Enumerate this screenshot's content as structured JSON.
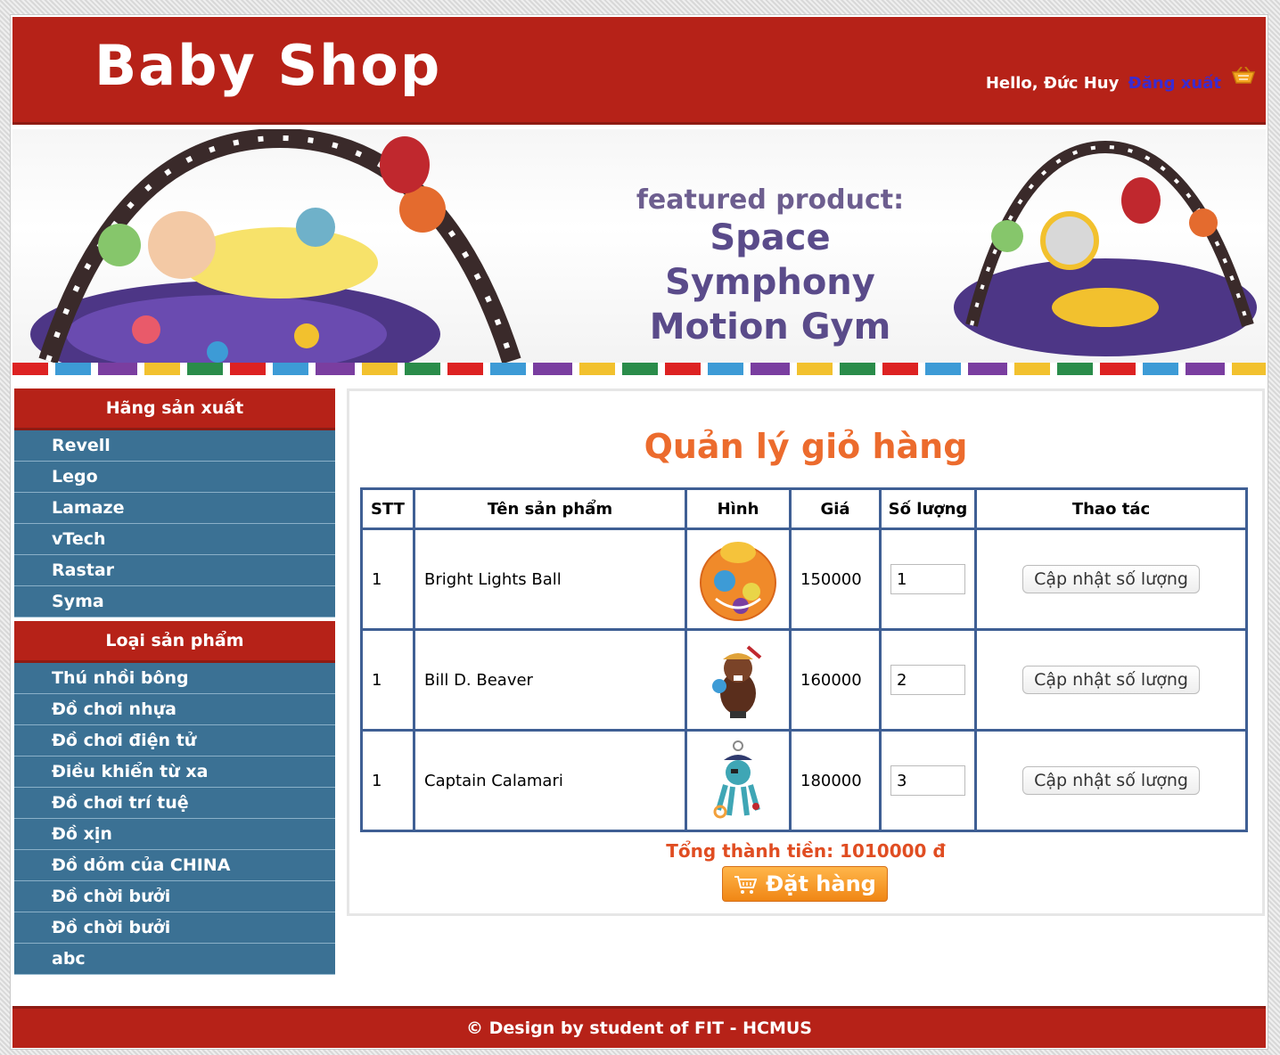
{
  "header": {
    "logo": "Baby Shop",
    "greeting": "Hello, Đức Huy",
    "logout": "Đăng xuất",
    "cart_icon": "basket-icon"
  },
  "banner": {
    "line1": "featured product:",
    "line2": "Space Symphony",
    "line3": "Motion Gym"
  },
  "sidebar": {
    "manufacturers_title": "Hãng sản xuất",
    "manufacturers": [
      "Revell",
      "Lego",
      "Lamaze",
      "vTech",
      "Rastar",
      "Syma"
    ],
    "categories_title": "Loại sản phẩm",
    "categories": [
      "Thú nhồi bông",
      "Đồ chơi nhựa",
      "Đồ chơi điện tử",
      "Điều khiển từ xa",
      "Đồ chơi trí tuệ",
      "Đồ xịn",
      "Đồ dỏm của CHINA",
      "Đồ chời bưởi",
      "Đồ chời bưởi",
      "abc"
    ]
  },
  "main": {
    "title": "Quản lý giỏ hàng",
    "columns": [
      "STT",
      "Tên sản phẩm",
      "Hình",
      "Giá",
      "Số lượng",
      "Thao tác"
    ],
    "rows": [
      {
        "stt": "1",
        "name": "Bright Lights Ball",
        "price": "150000",
        "qty": "1",
        "action": "Cập nhật số lượng"
      },
      {
        "stt": "1",
        "name": "Bill D. Beaver",
        "price": "160000",
        "qty": "2",
        "action": "Cập nhật số lượng"
      },
      {
        "stt": "1",
        "name": "Captain Calamari",
        "price": "180000",
        "qty": "3",
        "action": "Cập nhật số lượng"
      }
    ],
    "total": "Tổng thành tiền: 1010000 đ",
    "order_button": "Đặt hàng"
  },
  "footer": "© Design by student of FIT - HCMUS",
  "colors": {
    "header_red": "#b62218",
    "sidebar_blue": "#3b7194",
    "title_orange": "#ec6b2d",
    "table_border": "#3f5f94"
  }
}
